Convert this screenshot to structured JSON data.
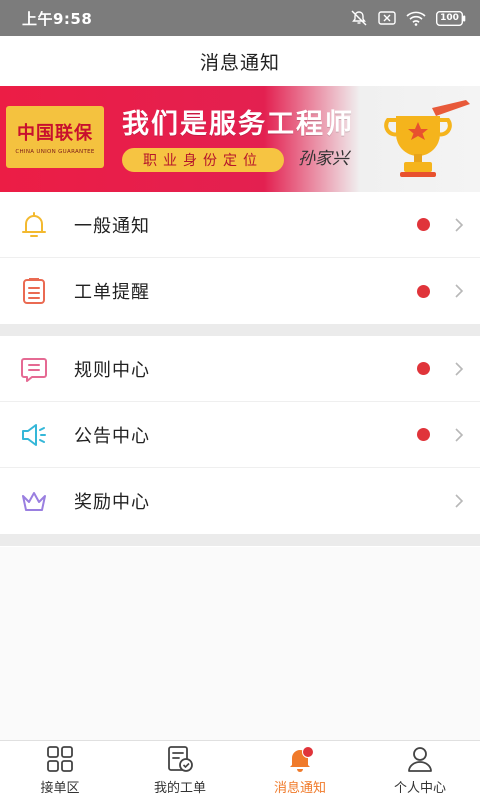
{
  "status_bar": {
    "time": "上午9:58",
    "battery": "100"
  },
  "header": {
    "title": "消息通知"
  },
  "banner": {
    "logo_text": "中国联保",
    "logo_subtext": "CHINA UNION GUARANTEE",
    "headline": "我们是服务工程师",
    "pill_text": "职业身份定位",
    "signature": "孙家兴"
  },
  "menu_groups": [
    {
      "items": [
        {
          "label": "一般通知",
          "icon": "bell-icon",
          "unread": true,
          "color": "#f3b92f"
        },
        {
          "label": "工单提醒",
          "icon": "clipboard-icon",
          "unread": true,
          "color": "#ea6a52"
        }
      ]
    },
    {
      "items": [
        {
          "label": "规则中心",
          "icon": "message-icon",
          "unread": true,
          "color": "#e56a93"
        },
        {
          "label": "公告中心",
          "icon": "speaker-icon",
          "unread": true,
          "color": "#35b7d8"
        },
        {
          "label": "奖励中心",
          "icon": "crown-icon",
          "unread": false,
          "color": "#9a7fe0"
        }
      ]
    }
  ],
  "tabbar": {
    "tabs": [
      {
        "label": "接单区",
        "icon": "grid-icon",
        "active": false
      },
      {
        "label": "我的工单",
        "icon": "order-icon",
        "active": false
      },
      {
        "label": "消息通知",
        "icon": "bell-icon",
        "active": true,
        "badge": true
      },
      {
        "label": "个人中心",
        "icon": "person-icon",
        "active": false
      }
    ]
  },
  "colors": {
    "accent": "#f07a2a",
    "unread_dot": "#e0343a",
    "banner_red": "#ec1d45",
    "banner_gold": "#f6c442"
  }
}
